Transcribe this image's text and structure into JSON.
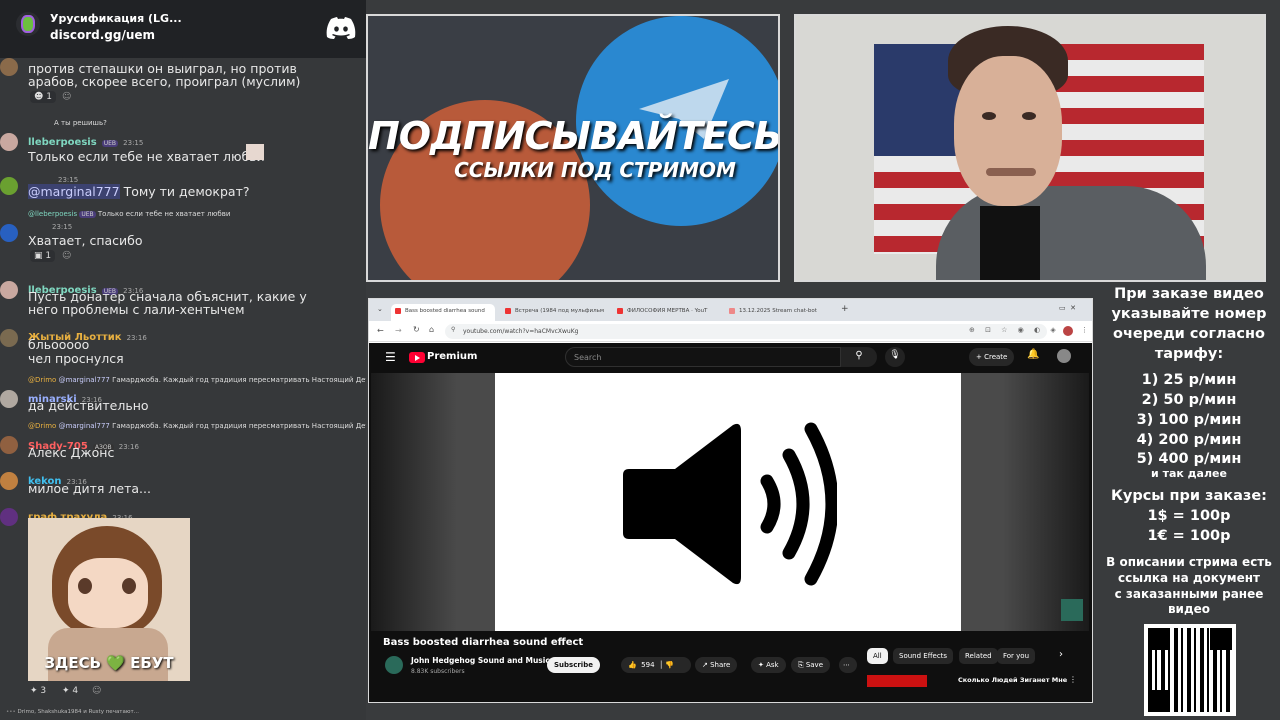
{
  "discord": {
    "server_name": "Урусификация (LG...",
    "invite": "discord.gg/uem",
    "typing": "Drimo, Shakshuka1984 и Rusty печатают..."
  },
  "chat": {
    "m1_text": "против степашки он выиграл, но против арабов, скорее всего, проиграл (муслим)",
    "m1_reaction": "1",
    "m2_reply": "А ты решишь?",
    "m2_name": "lleberpoesis",
    "m2_tag": "UEB",
    "m2_time": "23:15",
    "m2_text": "Только если тебе не хватает любви",
    "m3_time": "23:15",
    "m3_mention": "@marginal777",
    "m3_text": "Тому ти демократ?",
    "m4_reply_name": "@lleberpoesis",
    "m4_reply_tag": "UEB",
    "m4_reply_text": "Только если тебе не хватает любви",
    "m4_time": "23:15",
    "m4_text": "Хватает, спасибо",
    "m4_reaction": "1",
    "m5_name": "lleberpoesis",
    "m5_tag": "UEB",
    "m5_time": "23:16",
    "m5_text": "Пусть донатер сначала объяснит, какие у него проблемы с лали-хентычем",
    "m6_name": "Жытый Льоттик",
    "m6_time": "23:16",
    "m6_text1": "бльооооо",
    "m6_text2": "чел проснулся",
    "m7_reply_name": "@Drimo",
    "m7_reply_mention": "@marginal777",
    "m7_reply_text": "Гамарджоба. Каждый год традиция пересматривать Настоящий Детектив",
    "m7_name": "minarski",
    "m7_time": "23:16",
    "m7_text": "да действительно",
    "m8_reply_name": "@Drimo",
    "m8_reply_mention": "@marginal777",
    "m8_reply_text": "Гамарджоба. Каждый год традиция пересматривать Настоящий Детектив",
    "m8_name": "Shady-705",
    "m8_tag": "AЗОВ",
    "m8_time": "23:16",
    "m8_text": "Алекс Джонс",
    "m9_name": "kekon",
    "m9_time": "23:16",
    "m9_text": "милое дитя лета...",
    "m10_name": "граф трахула",
    "m10_time": "23:16",
    "m10_image_caption": "ЗДЕСЬ 💚 ЕБУТ",
    "m10_react1": "3",
    "m10_react2": "4"
  },
  "banner": {
    "line1": "ПОДПИСЫВАЙТЕСЬ",
    "line2": "ССЫЛКИ ПОД СТРИМОМ"
  },
  "browser": {
    "tabs": [
      "Bass boosted diarrhea sound",
      "Встреча (1984 под мульфильм",
      "ФИЛОСОФИЯ МЕРТВА · YouT",
      "13.12.2025 Stream chat-bot"
    ],
    "url": "youtube.com/watch?v=haCMvcXwuKg",
    "yt_brand": "Premium",
    "search_placeholder": "Search",
    "create_label": "Create",
    "video_title": "Bass boosted diarrhea sound effect",
    "channel_name": "John Hedgehog Sound and Music",
    "subscribers": "8.83K subscribers",
    "subscribe_label": "Subscribe",
    "likes": "594",
    "share_label": "Share",
    "ask_label": "Ask",
    "save_label": "Save",
    "chips": [
      "All",
      "Sound Effects",
      "Related",
      "For you"
    ],
    "rec_title": "Сколько Людей Зиганет Мне"
  },
  "right": {
    "line1": "При заказе видео",
    "line2": "указывайте номер",
    "line3": "очереди согласно",
    "line4": "тарифу:",
    "p1": "1) 25 р/мин",
    "p2": "2) 50 р/мин",
    "p3": "3) 100 р/мин",
    "p4": "4) 200 р/мин",
    "p5": "5) 400 р/мин",
    "p_more": "и так далее",
    "rates_title": "Курсы при заказе:",
    "rate1": "1$ = 100р",
    "rate2": "1€ = 100р",
    "d1": "В описании стрима есть",
    "d2": "ссылка на документ",
    "d3": "с заказанными ранее",
    "d4": "видео"
  },
  "colors": {
    "youtube_red": "#ff0033",
    "discord_blurple": "#5865f2",
    "telegram_blue": "#229ed9"
  }
}
